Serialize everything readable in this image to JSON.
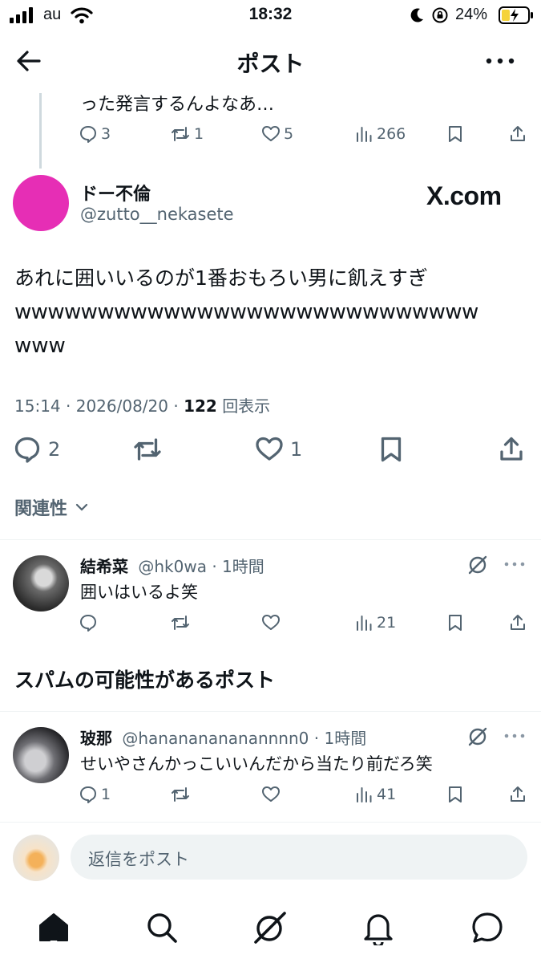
{
  "status_bar": {
    "carrier": "au",
    "time": "18:32",
    "battery": "24%"
  },
  "header": {
    "title": "ポスト"
  },
  "parent_post": {
    "text": "った発言するんよなあ…",
    "replies": "3",
    "reposts": "1",
    "likes": "5",
    "views": "266"
  },
  "main_post": {
    "display_name": "ドー不倫",
    "handle": "@zutto__nekasete",
    "watermark": "X.com",
    "text_line1": "あれに囲いいるのが1番おもろい男に飢えすぎ",
    "text_line2": "wwwwwwwwwwwwwwwwwwwwwwwwwwww",
    "text_line3": "www",
    "time": "15:14",
    "date": "2026/08/20",
    "views_count": "122",
    "views_label": "回表示",
    "replies": "2",
    "likes": "1",
    "avatar_color": "#e62eb5"
  },
  "sort": {
    "label": "関連性"
  },
  "replies": [
    {
      "display_name": "結希菜",
      "handle": "@hk0wa",
      "age": "1時間",
      "text": "囲いはいるよ笑",
      "views": "21"
    }
  ],
  "spam_section": {
    "title": "スパムの可能性があるポスト"
  },
  "spam_replies": [
    {
      "display_name": "玻那",
      "handle": "@hanananananannnn0",
      "age": "1時間",
      "text": "せいやさんかっこいいんだから当たり前だろ笑",
      "replies": "1",
      "views": "41"
    }
  ],
  "composer": {
    "placeholder": "返信をポスト"
  },
  "colors": {
    "accent": "#1d9bf0",
    "muted": "#536471",
    "battery": "#f5d33a"
  }
}
